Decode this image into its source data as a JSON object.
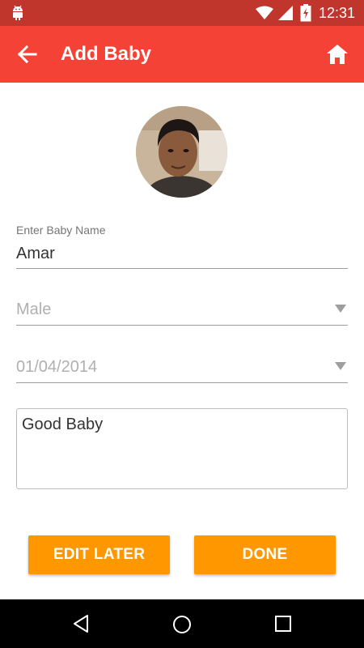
{
  "status_bar": {
    "time": "12:31",
    "icons": [
      "android-icon",
      "wifi-icon",
      "signal-icon",
      "battery-icon"
    ]
  },
  "app_bar": {
    "title": "Add Baby",
    "back_icon": "arrow-left-icon",
    "home_icon": "home-icon",
    "color": "#f44336"
  },
  "form": {
    "name_label": "Enter Baby Name",
    "name_value": "Amar",
    "gender_value": "Male",
    "birthdate_value": "01/04/2014",
    "notes_value": "Good Baby"
  },
  "buttons": {
    "edit_later": "EDIT LATER",
    "done": "DONE",
    "color": "#ff9800"
  },
  "nav_bar": {
    "icons": [
      "back-triangle-icon",
      "home-circle-icon",
      "recents-square-icon"
    ]
  }
}
